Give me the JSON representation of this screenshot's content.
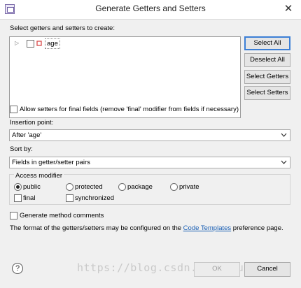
{
  "window": {
    "title": "Generate Getters and Setters",
    "close_glyph": "✕",
    "app_icon": "eclipse-dialog-icon"
  },
  "prompt_label": "Select getters and setters to create:",
  "tree": {
    "items": [
      {
        "label": "age",
        "expander": "▷",
        "checked": false,
        "icon": "private-field-icon",
        "icon_color": "#d94a4a"
      }
    ]
  },
  "side_buttons": {
    "select_all": "Select All",
    "deselect_all": "Deselect All",
    "select_getters": "Select Getters",
    "select_setters": "Select Setters"
  },
  "allow_final": {
    "label": "Allow setters for final fields (remove 'final' modifier from fields if necessary)",
    "checked": false
  },
  "insertion_point": {
    "label": "Insertion point:",
    "value": "After 'age'"
  },
  "sort_by": {
    "label": "Sort by:",
    "value": "Fields in getter/setter pairs"
  },
  "access_modifier": {
    "legend": "Access modifier",
    "options": [
      {
        "label": "public",
        "selected": true
      },
      {
        "label": "protected",
        "selected": false
      },
      {
        "label": "package",
        "selected": false
      },
      {
        "label": "private",
        "selected": false
      }
    ],
    "final": {
      "label": "final",
      "checked": false
    },
    "synchronized": {
      "label": "synchronized",
      "checked": false
    }
  },
  "generate_comments": {
    "label": "Generate method comments",
    "checked": false
  },
  "info": {
    "prefix": "The format of the getters/setters may be configured on the",
    "link": "Code Templates",
    "suffix": "preference page."
  },
  "footer": {
    "help_glyph": "?",
    "ok": "OK",
    "cancel": "Cancel",
    "watermark": "https://blog.csdn.net/Blues_lin"
  },
  "colors": {
    "accent": "#3c7fd6",
    "link": "#1a5fb4",
    "field_icon": "#d94a4a"
  }
}
